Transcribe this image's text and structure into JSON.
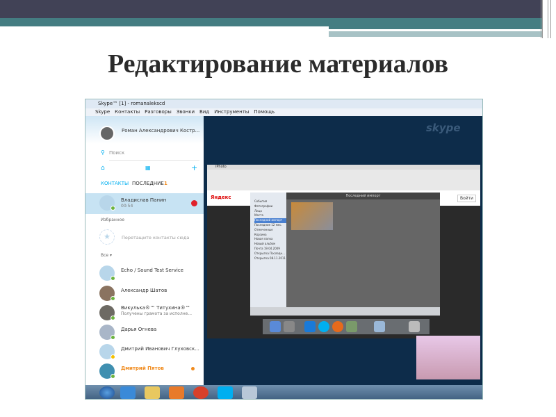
{
  "slide": {
    "title": "Редактирование материалов"
  },
  "window": {
    "title": "Skype™ [1] - romanaleksсd",
    "menu": [
      "Skype",
      "Контакты",
      "Разговоры",
      "Звонки",
      "Вид",
      "Инструменты",
      "Помощь"
    ]
  },
  "profile": {
    "name": "Роман Александрович Костр..."
  },
  "search": {
    "placeholder": "Поиск"
  },
  "tabs": {
    "contacts": "КОНТАКТЫ",
    "recent": "ПОСЛЕДНИЕ",
    "recent_count": "1"
  },
  "active_call": {
    "name": "Владислав Панин",
    "time": "00:54"
  },
  "favorites": {
    "label": "Избранное",
    "hint": "Перетащите контакты сюда"
  },
  "filter": "Все ▾",
  "contacts": [
    {
      "name": "Echo / Sound Test Service",
      "sub": ""
    },
    {
      "name": "Александр Шатов",
      "sub": ""
    },
    {
      "name": "Викулька®™ Титухина®™",
      "sub": "Получены грамота за исполне..."
    },
    {
      "name": "Дарья Огнева",
      "sub": ""
    },
    {
      "name": "Дмитрий Иванович Глуховск...",
      "sub": ""
    },
    {
      "name": "Дмитрий Пятов",
      "sub": ""
    }
  ],
  "shared_screen": {
    "app": "iPhoto",
    "pane_title": "Последний импорт",
    "logo": "Яндекс",
    "login": "Войти",
    "sidebar": [
      "События",
      "Фотографии",
      "Лица",
      "Места",
      "Последний импорт",
      "Последние 12 мес.",
      "Отмеченные",
      "Корзина",
      "Новая папка",
      "Новый альбом",
      "Почта 19.04.2009",
      "Открытка Последн...",
      "Открытка 08.11.2011"
    ]
  },
  "brand": "skype",
  "colors": {
    "accent": "#00aff0",
    "call_end": "#e0202a",
    "orange": "#f08a1c"
  }
}
